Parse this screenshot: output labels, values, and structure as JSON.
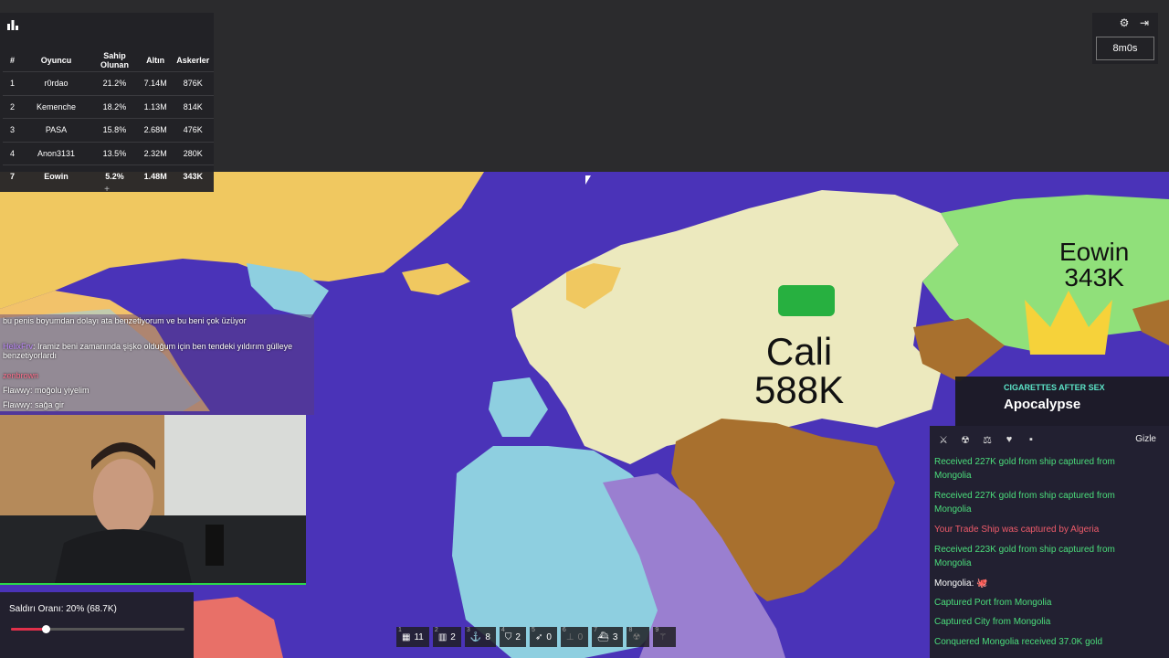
{
  "leaderboard": {
    "headers": [
      "#",
      "Oyuncu",
      "Sahip Olunan",
      "Altın",
      "Askerler"
    ],
    "rows": [
      {
        "rank": "1",
        "player": "r0rdao",
        "owned": "21.2%",
        "gold": "7.14M",
        "troops": "876K"
      },
      {
        "rank": "2",
        "player": "Kemenche",
        "owned": "18.2%",
        "gold": "1.13M",
        "troops": "814K"
      },
      {
        "rank": "3",
        "player": "PASA",
        "owned": "15.8%",
        "gold": "2.68M",
        "troops": "476K"
      },
      {
        "rank": "4",
        "player": "Anon3131",
        "owned": "13.5%",
        "gold": "2.32M",
        "troops": "280K"
      },
      {
        "rank": "7",
        "player": "Eowin",
        "owned": "5.2%",
        "gold": "1.48M",
        "troops": "343K"
      }
    ],
    "expand_label": "+"
  },
  "timer": "8m0s",
  "map_labels": [
    {
      "name": "Cali",
      "troops": "588K"
    },
    {
      "name": "Eowin",
      "troops": "343K"
    }
  ],
  "chat": [
    {
      "user": "",
      "text": "bu penis boyumdan dolayı ata benzetiyorum ve bu beni çok üzüyor"
    },
    {
      "user": "HelixFrv",
      "text": ": Iramiz beni zamanında şişko olduğum için ben tendeki yıldırım gülleye benzetiyorlardı"
    },
    {
      "user": "zenbrown",
      "text": ""
    },
    {
      "user": "Flawwy",
      "text": ": moğolu yiyelim"
    },
    {
      "user": "Flawwy",
      "text": ": sağa gir"
    }
  ],
  "attack": {
    "label": "Saldırı Oranı: 20% (68.7K)",
    "ratio": 0.2
  },
  "music": {
    "artist": "CIGARETTES AFTER SEX",
    "title": "Apocalypse"
  },
  "log": {
    "hide_label": "Gizle",
    "messages": [
      {
        "text": "Received 227K gold from ship captured from Mongolia",
        "color": "green"
      },
      {
        "text": "Received 227K gold from ship captured from Mongolia",
        "color": "green"
      },
      {
        "text": "Your Trade Ship was captured by Algeria",
        "color": "red"
      },
      {
        "text": "Received 223K gold from ship captured from Mongolia",
        "color": "green"
      },
      {
        "text": "Mongolia: 🐙",
        "color": "white"
      },
      {
        "text": "Captured Port from Mongolia",
        "color": "green"
      },
      {
        "text": "Captured City from Mongolia",
        "color": "green"
      },
      {
        "text": "Conquered Mongolia received 37.0K gold",
        "color": "green"
      }
    ]
  },
  "build_bar": [
    {
      "key": "1",
      "icon": "city-icon",
      "count": "11"
    },
    {
      "key": "2",
      "icon": "factory-icon",
      "count": "2"
    },
    {
      "key": "3",
      "icon": "port-icon",
      "count": "8"
    },
    {
      "key": "4",
      "icon": "defense-post-icon",
      "count": "2"
    },
    {
      "key": "5",
      "icon": "missile-silo-icon",
      "count": "0"
    },
    {
      "key": "6",
      "icon": "sam-launcher-icon",
      "count": "0"
    },
    {
      "key": "7",
      "icon": "warship-icon",
      "count": "3"
    },
    {
      "key": "8",
      "icon": "nuke-icon",
      "count": ""
    },
    {
      "key": "9",
      "icon": "mirv-icon",
      "count": ""
    }
  ],
  "colors": {
    "ocean": "#4a33b8",
    "cali": "#ece9be",
    "eowin": "#90e07a",
    "yellow": "#f0c860",
    "brown": "#a8702e",
    "blue": "#8ecfe0",
    "purple": "#9a7fd0"
  }
}
